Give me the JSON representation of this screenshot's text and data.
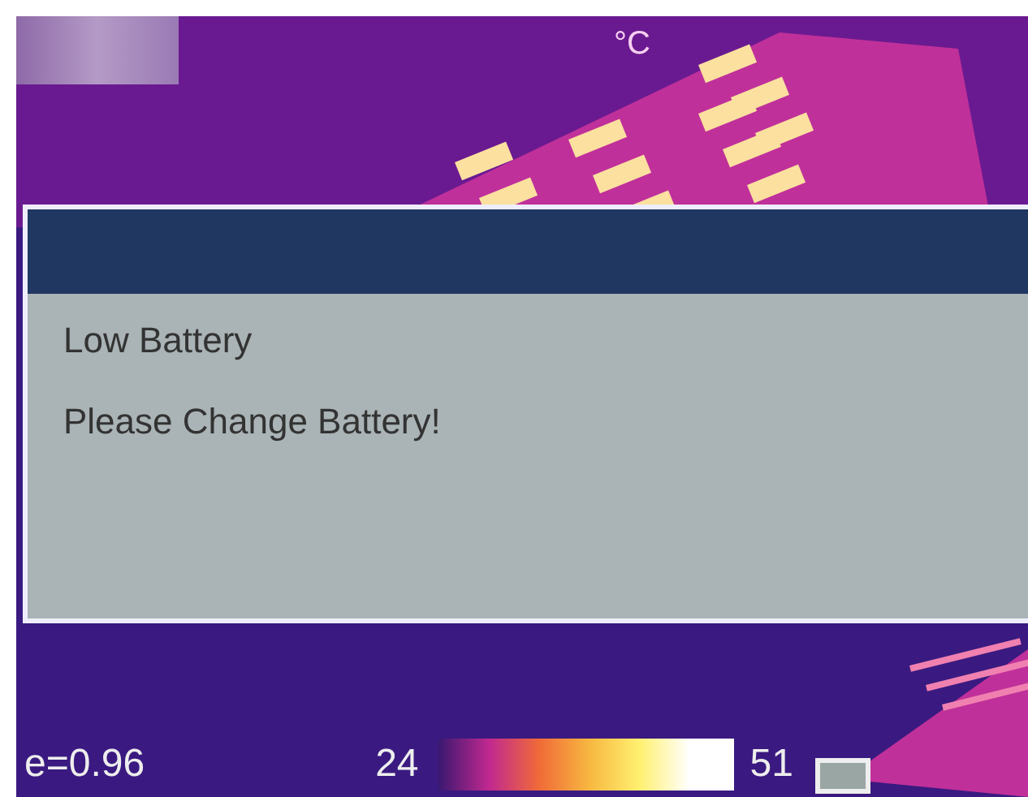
{
  "unit": "°C",
  "dialog": {
    "title_line": "Low Battery",
    "message": "Please Change Battery!"
  },
  "status_bar": {
    "emissivity": "e=0.96",
    "scale_min": "24",
    "scale_max": "51"
  }
}
